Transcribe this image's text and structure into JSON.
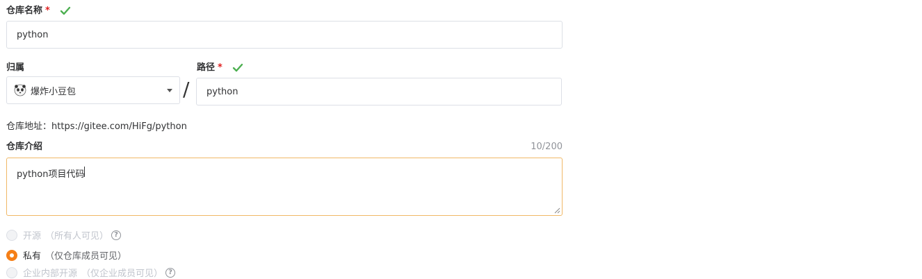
{
  "repo_name": {
    "label": "仓库名称",
    "required_mark": "*",
    "value": "python"
  },
  "owner": {
    "label": "归属",
    "value": "爆炸小豆包",
    "avatar_icon": "panda-avatar-icon"
  },
  "separator": "/",
  "path": {
    "label": "路径",
    "required_mark": "*",
    "value": "python"
  },
  "repo_address": {
    "label": "仓库地址：",
    "url": "https://gitee.com/HiFg/python"
  },
  "description": {
    "label": "仓库介绍",
    "counter": "10/200",
    "value": "python项目代码"
  },
  "visibility": {
    "options": [
      {
        "label": "开源",
        "note": "（所有人可见）",
        "selected": false,
        "disabled": true,
        "has_help": true
      },
      {
        "label": "私有",
        "note": "（仅仓库成员可见）",
        "selected": true,
        "disabled": false,
        "has_help": false
      },
      {
        "label": "企业内部开源",
        "note": "（仅企业成员可见）",
        "selected": false,
        "disabled": true,
        "has_help": true
      }
    ],
    "help_glyph": "?"
  },
  "colors": {
    "accent": "#f57f17",
    "valid_check": "#4caf50",
    "required": "#e02020",
    "focus_border": "#f0b866"
  }
}
